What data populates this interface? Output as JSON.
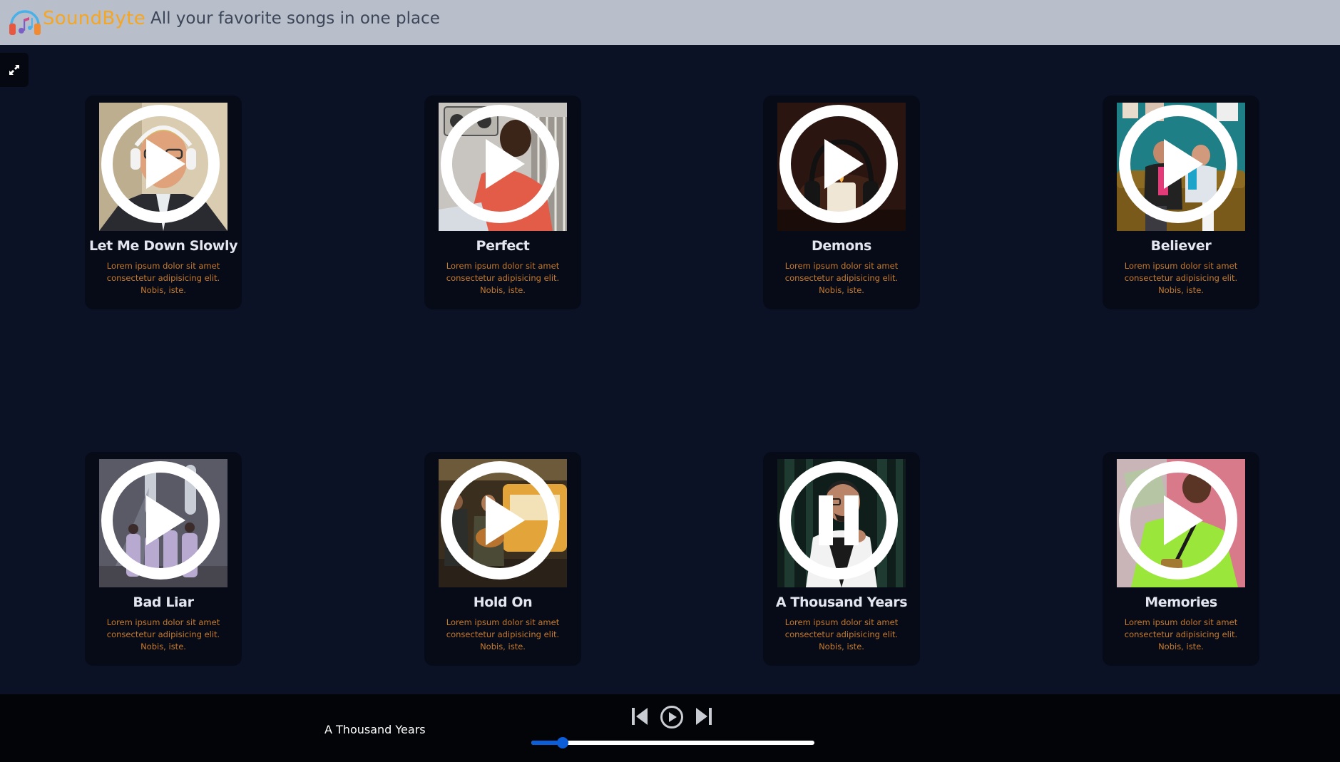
{
  "header": {
    "brand": "SoundByte",
    "tagline": "All your favorite songs in one place"
  },
  "songs": [
    {
      "title": "Let Me Down Slowly",
      "description": "Lorem ipsum dolor sit amet consectetur adipisicing elit. Nobis, iste.",
      "state_icon": "play-icon"
    },
    {
      "title": "Perfect",
      "description": "Lorem ipsum dolor sit amet consectetur adipisicing elit. Nobis, iste.",
      "state_icon": "play-icon"
    },
    {
      "title": "Demons",
      "description": "Lorem ipsum dolor sit amet consectetur adipisicing elit. Nobis, iste.",
      "state_icon": "play-icon"
    },
    {
      "title": "Believer",
      "description": "Lorem ipsum dolor sit amet consectetur adipisicing elit. Nobis, iste.",
      "state_icon": "play-icon"
    },
    {
      "title": "Bad Liar",
      "description": "Lorem ipsum dolor sit amet consectetur adipisicing elit. Nobis, iste.",
      "state_icon": "play-icon"
    },
    {
      "title": "Hold On",
      "description": "Lorem ipsum dolor sit amet consectetur adipisicing elit. Nobis, iste.",
      "state_icon": "play-icon"
    },
    {
      "title": "A Thousand Years",
      "description": "Lorem ipsum dolor sit amet consectetur adipisicing elit. Nobis, iste.",
      "state_icon": "pause-icon"
    },
    {
      "title": "Memories",
      "description": "Lorem ipsum dolor sit amet consectetur adipisicing elit. Nobis, iste.",
      "state_icon": "play-icon"
    }
  ],
  "player": {
    "now_playing": "A Thousand Years",
    "progress_fraction": 0.11,
    "controls": [
      "previous-icon",
      "play-icon",
      "next-icon"
    ]
  },
  "colors": {
    "background": "#0b1226",
    "header": "#b8bfca",
    "brand": "#f5a623",
    "card": "#070b17",
    "description": "#c67a2c",
    "progress": "#0b5ed7"
  }
}
